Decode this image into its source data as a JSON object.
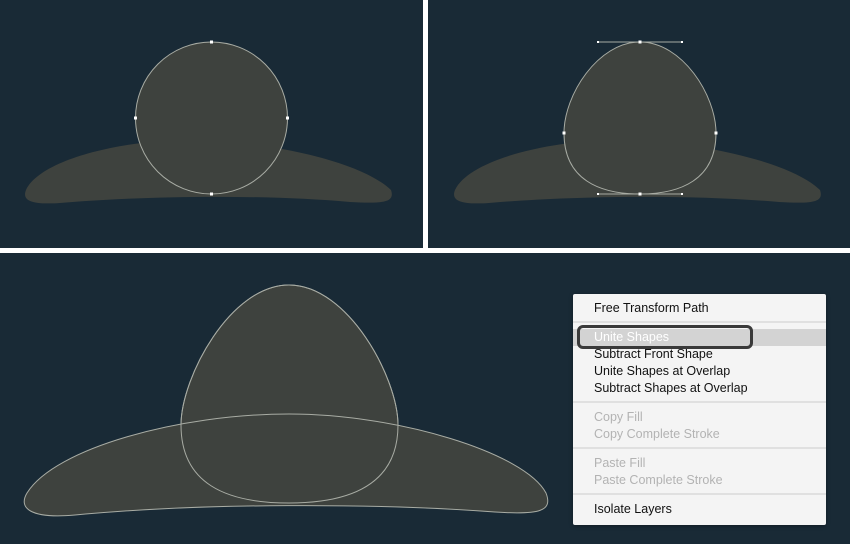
{
  "colors": {
    "canvas_background": "#192a36",
    "shape_fill": "#3e423e",
    "path_stroke": "#a8aca4",
    "anchor_point": "#ffffff",
    "menu_background": "#f4f4f4",
    "menu_highlight": "#d3d3d3",
    "menu_text": "#111111",
    "menu_disabled_text": "#b3b3b3"
  },
  "context_menu": {
    "items": [
      {
        "label": "Free Transform Path",
        "enabled": true,
        "highlighted": false
      },
      {
        "label": "Unite Shapes",
        "enabled": true,
        "highlighted": true
      },
      {
        "label": "Subtract Front Shape",
        "enabled": true,
        "highlighted": false
      },
      {
        "label": "Unite Shapes at Overlap",
        "enabled": true,
        "highlighted": false
      },
      {
        "label": "Subtract Shapes at Overlap",
        "enabled": true,
        "highlighted": false
      },
      {
        "label": "Copy Fill",
        "enabled": false,
        "highlighted": false
      },
      {
        "label": "Copy Complete Stroke",
        "enabled": false,
        "highlighted": false
      },
      {
        "label": "Paste Fill",
        "enabled": false,
        "highlighted": false
      },
      {
        "label": "Paste Complete Stroke",
        "enabled": false,
        "highlighted": false
      },
      {
        "label": "Isolate Layers",
        "enabled": true,
        "highlighted": false
      }
    ]
  }
}
